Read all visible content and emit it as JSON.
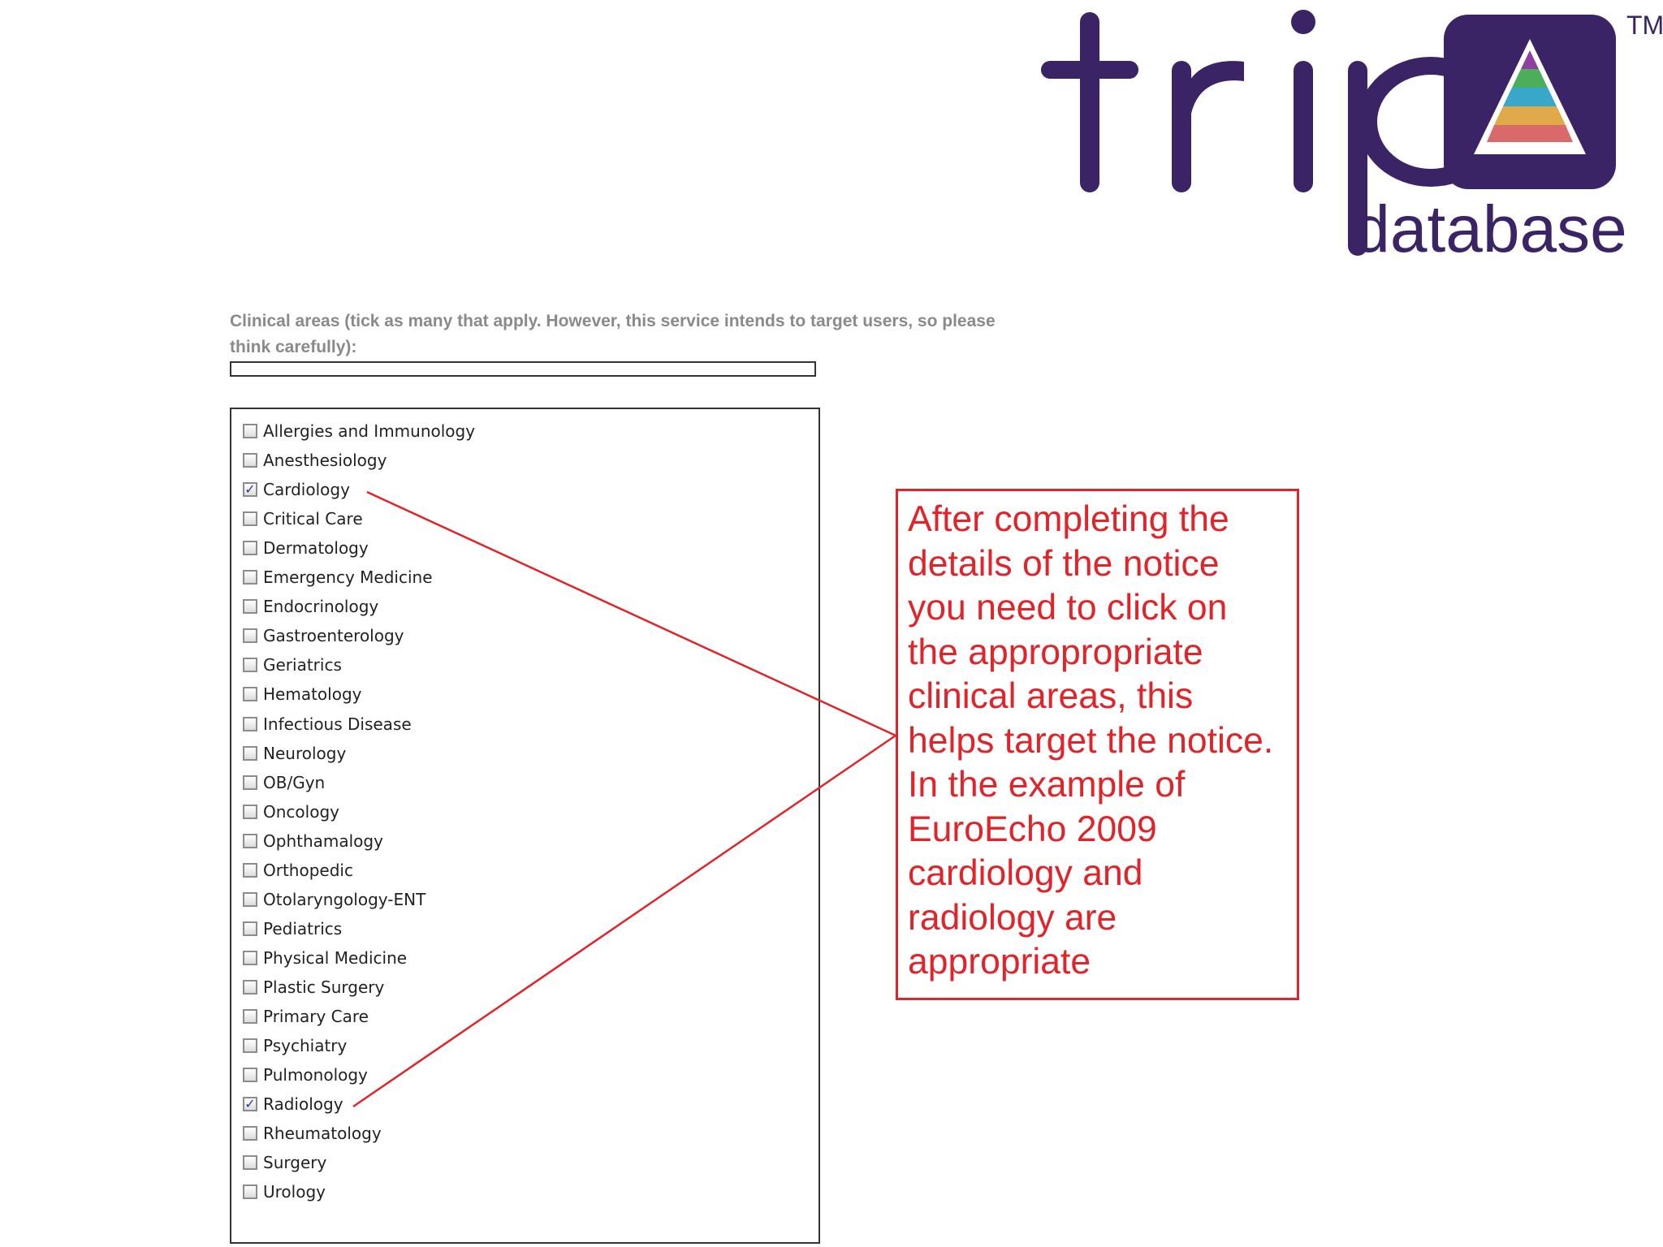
{
  "logo": {
    "word": "trip",
    "subword": "database",
    "trademark": "TM",
    "colors": {
      "brand": "#3b2466",
      "pyramid": [
        "#8f3fa0",
        "#4cae5a",
        "#39a7c9",
        "#e0a94a",
        "#d86a6a"
      ]
    }
  },
  "form": {
    "instructions": "Clinical areas (tick as many that apply. However, this service intends to target users, so please think carefully):",
    "text_field_value": ""
  },
  "clinical_areas": [
    {
      "label": "Allergies and Immunology",
      "checked": false
    },
    {
      "label": "Anesthesiology",
      "checked": false
    },
    {
      "label": "Cardiology",
      "checked": true
    },
    {
      "label": "Critical Care",
      "checked": false
    },
    {
      "label": "Dermatology",
      "checked": false
    },
    {
      "label": "Emergency Medicine",
      "checked": false
    },
    {
      "label": "Endocrinology",
      "checked": false
    },
    {
      "label": "Gastroenterology",
      "checked": false
    },
    {
      "label": "Geriatrics",
      "checked": false
    },
    {
      "label": "Hematology",
      "checked": false
    },
    {
      "label": "Infectious Disease",
      "checked": false
    },
    {
      "label": "Neurology",
      "checked": false
    },
    {
      "label": "OB/Gyn",
      "checked": false
    },
    {
      "label": "Oncology",
      "checked": false
    },
    {
      "label": "Ophthamalogy",
      "checked": false
    },
    {
      "label": "Orthopedic",
      "checked": false
    },
    {
      "label": "Otolaryngology-ENT",
      "checked": false
    },
    {
      "label": "Pediatrics",
      "checked": false
    },
    {
      "label": "Physical Medicine",
      "checked": false
    },
    {
      "label": "Plastic Surgery",
      "checked": false
    },
    {
      "label": "Primary Care",
      "checked": false
    },
    {
      "label": "Psychiatry",
      "checked": false
    },
    {
      "label": "Pulmonology",
      "checked": false
    },
    {
      "label": "Radiology",
      "checked": true
    },
    {
      "label": "Rheumatology",
      "checked": false
    },
    {
      "label": "Surgery",
      "checked": false
    },
    {
      "label": "Urology",
      "checked": false
    }
  ],
  "callout": {
    "text": "After completing the\ndetails of the notice\nyou need to click on\nthe appropropriate\nclinical areas, this\nhelps target the notice.\nIn the example of\nEuroEcho 2009\ncardiology and\nradiology are\nappropriate",
    "color": "#e0242a"
  }
}
